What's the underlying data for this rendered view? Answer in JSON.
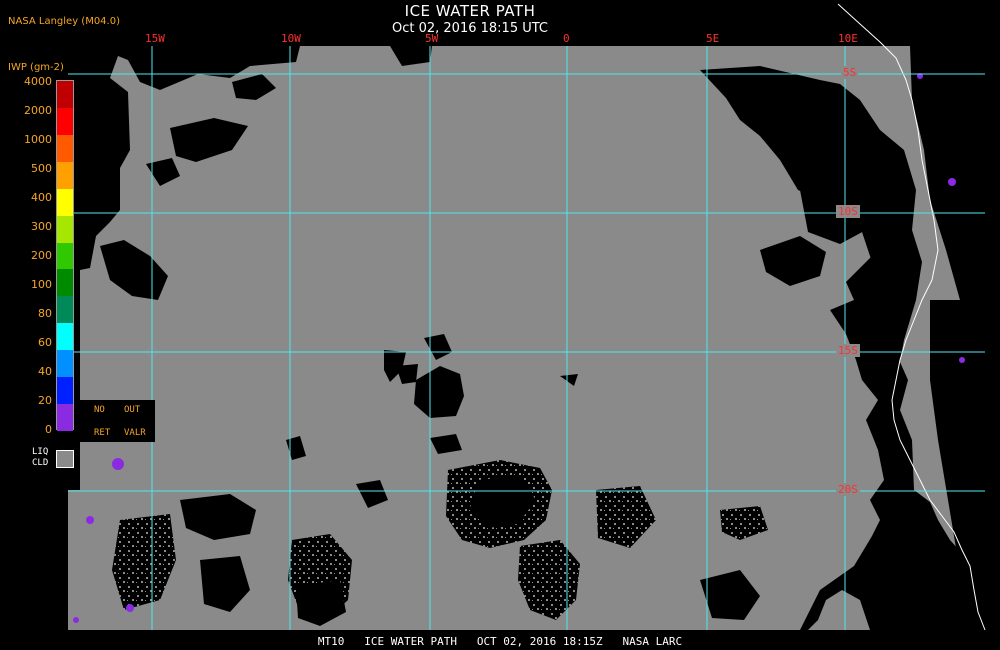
{
  "header": {
    "title": "ICE WATER PATH",
    "timestamp": "Oct 02, 2016 18:15 UTC",
    "organization": "NASA Langley (M04.0)"
  },
  "grid": {
    "longitude_labels": [
      "15W",
      "10W",
      "5W",
      "0",
      "5E",
      "10E"
    ],
    "latitude_labels": [
      "5S",
      "10S",
      "15S",
      "20S"
    ],
    "line_color": "#4fe8ef",
    "label_color": "#ff3030"
  },
  "legend": {
    "unit_label": "IWP (gm-2)",
    "levels": [
      {
        "label": "4000",
        "color": "#6b0000"
      },
      {
        "label": "2000",
        "color": "#c00000"
      },
      {
        "label": "1000",
        "color": "#ff0000"
      },
      {
        "label": "500",
        "color": "#ff5a00"
      },
      {
        "label": "400",
        "color": "#ffa000"
      },
      {
        "label": "300",
        "color": "#ffff00"
      },
      {
        "label": "200",
        "color": "#a6e600"
      },
      {
        "label": "100",
        "color": "#30c800"
      },
      {
        "label": "80",
        "color": "#008a00"
      },
      {
        "label": "60",
        "color": "#008a5a"
      },
      {
        "label": "40",
        "color": "#00ffff"
      },
      {
        "label": "20",
        "color": "#0090ff"
      },
      {
        "label": "0",
        "color": "#0020ff"
      }
    ],
    "bottom_color": "#8a2be2",
    "no_retrieval": {
      "line1_left": "NO",
      "line1_right": "OUT",
      "line2_left": "RET",
      "line2_right": "VALR"
    },
    "liquid_cloud": {
      "line1": "LIQ",
      "line2": "CLD",
      "color": "#8a8a8a"
    }
  },
  "map_colors": {
    "liquid_cloud": "#8a8a8a",
    "clear": "#000000",
    "thin_ice": "#8a2be2",
    "coastline": "#ffffff"
  },
  "footer": {
    "text": "MT10   ICE WATER PATH   OCT 02, 2016 18:15Z   NASA LARC"
  }
}
